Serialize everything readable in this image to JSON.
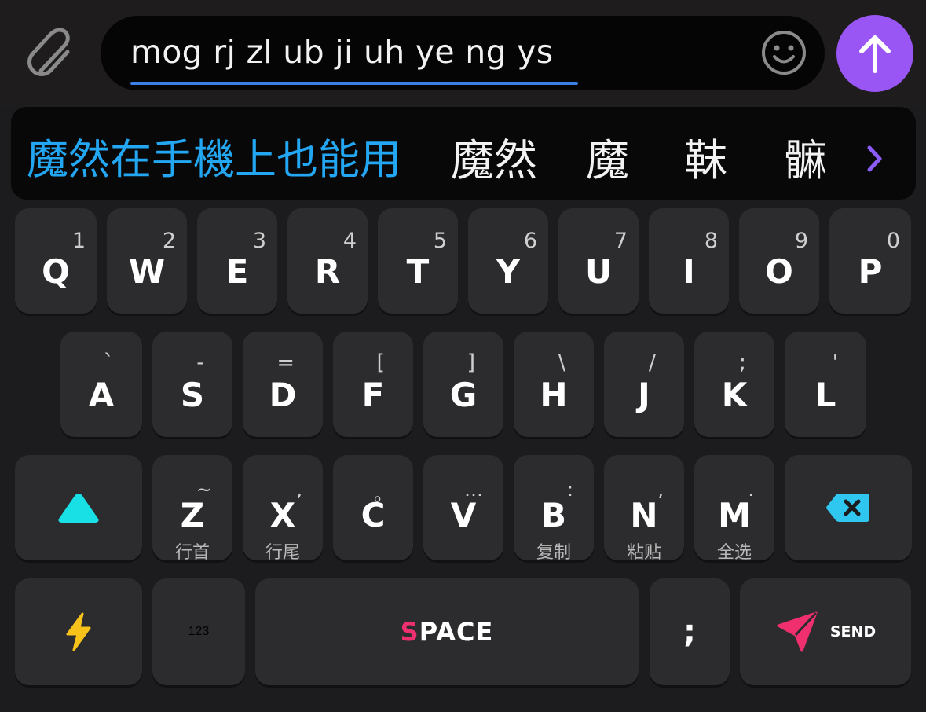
{
  "composer": {
    "message_text": "mog rj zl ub ji uh ye ng ys"
  },
  "candidates": {
    "items": [
      "魔然在手機上也能用",
      "魔然",
      "魔",
      "靺",
      "髍"
    ],
    "highlight_color": "#23a7f2"
  },
  "keyboard": {
    "row1": [
      {
        "label": "Q",
        "hint": "1"
      },
      {
        "label": "W",
        "hint": "2"
      },
      {
        "label": "E",
        "hint": "3"
      },
      {
        "label": "R",
        "hint": "4"
      },
      {
        "label": "T",
        "hint": "5"
      },
      {
        "label": "Y",
        "hint": "6"
      },
      {
        "label": "U",
        "hint": "7"
      },
      {
        "label": "I",
        "hint": "8"
      },
      {
        "label": "O",
        "hint": "9"
      },
      {
        "label": "P",
        "hint": "0"
      }
    ],
    "row2": [
      {
        "label": "A",
        "hint": "`"
      },
      {
        "label": "S",
        "hint": "-"
      },
      {
        "label": "D",
        "hint": "="
      },
      {
        "label": "F",
        "hint": "["
      },
      {
        "label": "G",
        "hint": "]"
      },
      {
        "label": "H",
        "hint": "\\"
      },
      {
        "label": "J",
        "hint": "/"
      },
      {
        "label": "K",
        "hint": ";"
      },
      {
        "label": "L",
        "hint": "'"
      }
    ],
    "row3": [
      {
        "label": "Z",
        "hint": "~",
        "sub": "行首"
      },
      {
        "label": "X",
        "hint": ",",
        "sub": "行尾"
      },
      {
        "label": "C",
        "hint": "。",
        "sub": ""
      },
      {
        "label": "V",
        "hint": "…",
        "sub": ""
      },
      {
        "label": "B",
        "hint": ":",
        "sub": "复制"
      },
      {
        "label": "N",
        "hint": ",",
        "sub": "粘贴"
      },
      {
        "label": "M",
        "hint": ".",
        "sub": "全选"
      }
    ],
    "number_label": "123",
    "space_label_first": "S",
    "space_label_rest": "PACE",
    "semicolon_label": ";",
    "send_label": "SEND"
  },
  "colors": {
    "send_button": "#9a55f5",
    "shift_icon": "#19e0e5",
    "backspace_icon": "#2fc7f0",
    "lightning_icon": "#f7c21a",
    "send_icon": "#f0306e",
    "underline": "#3d7fe8"
  },
  "icons": {
    "attach": "paperclip-icon",
    "emoji": "smiley-icon",
    "send_message": "arrow-up-icon",
    "candidate_more": "chevron-right-icon",
    "shift": "triangle-shift-icon",
    "backspace": "backspace-icon",
    "quick": "lightning-icon",
    "send_key": "paper-plane-icon"
  }
}
